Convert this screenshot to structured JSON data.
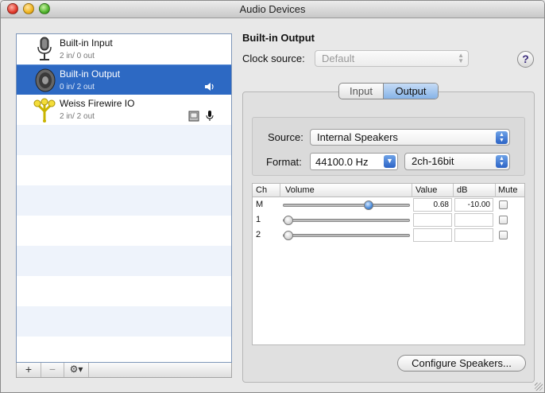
{
  "window": {
    "title": "Audio Devices"
  },
  "devices": [
    {
      "name": "Built-in Input",
      "channels": "2 in/ 0 out",
      "icon": "microphone-icon"
    },
    {
      "name": "Built-in Output",
      "channels": "0 in/ 2 out",
      "icon": "speaker-icon",
      "status_icons": [
        "speaker-output-icon"
      ],
      "selected": true
    },
    {
      "name": "Weiss Firewire IO",
      "channels": "2 in/ 2 out",
      "icon": "firewire-icon",
      "status_icons": [
        "finder-icon",
        "microphone-input-icon"
      ]
    }
  ],
  "list_toolbar": {
    "add": "+",
    "remove": "−",
    "gear": "⚙▾"
  },
  "detail": {
    "title": "Built-in Output",
    "clock_label": "Clock source:",
    "clock_value": "Default",
    "help": "?",
    "tabs": [
      "Input",
      "Output"
    ],
    "active_tab": "Output",
    "source_label": "Source:",
    "source_value": "Internal Speakers",
    "format_label": "Format:",
    "format_rate": "44100.0 Hz",
    "format_bits": "2ch-16bit",
    "table": {
      "headers": [
        "Ch",
        "Volume",
        "Value",
        "dB",
        "Mute"
      ],
      "rows": [
        {
          "ch": "M",
          "volume": 0.68,
          "value": "0.68",
          "db": "-10.00",
          "muted": false
        },
        {
          "ch": "1",
          "volume": 0.0,
          "value": "",
          "db": "",
          "muted": false
        },
        {
          "ch": "2",
          "volume": 0.0,
          "value": "",
          "db": "",
          "muted": false
        }
      ]
    },
    "configure_button": "Configure Speakers..."
  },
  "colors": {
    "selection": "#2d69c3",
    "accent": "#4a8bdb"
  }
}
